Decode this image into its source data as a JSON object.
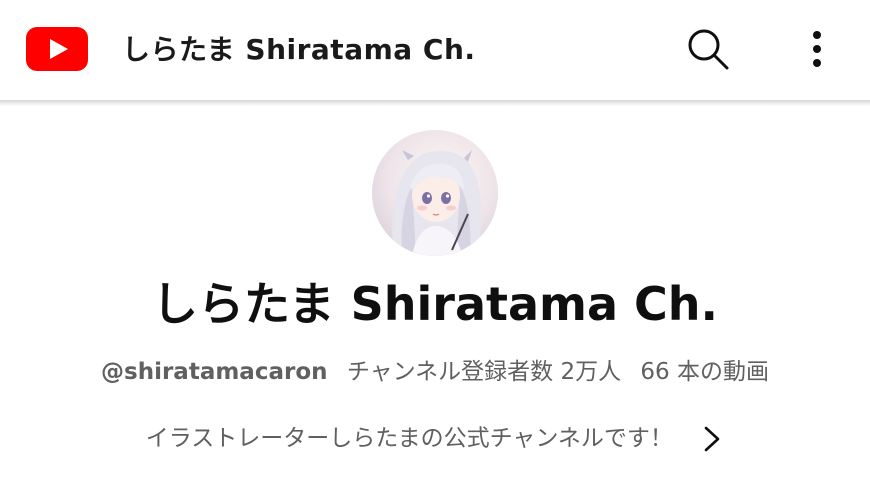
{
  "header": {
    "logo_icon": "youtube-logo-icon",
    "title": "しらたま Shiratama Ch.",
    "search_icon": "search-icon",
    "more_icon": "more-vert-icon"
  },
  "channel": {
    "avatar_icon": "channel-avatar",
    "name": "しらたま Shiratama Ch.",
    "handle": "@shiratamacaron",
    "subscribers": "チャンネル登録者数 2万人",
    "videos": "66 本の動画",
    "description": "イラストレーターしらたまの公式チャンネルです！",
    "description_more_icon": "chevron-right-icon"
  },
  "colors": {
    "brand_red": "#ff0000",
    "text_primary": "#0f0f0f",
    "text_secondary": "#606060"
  }
}
